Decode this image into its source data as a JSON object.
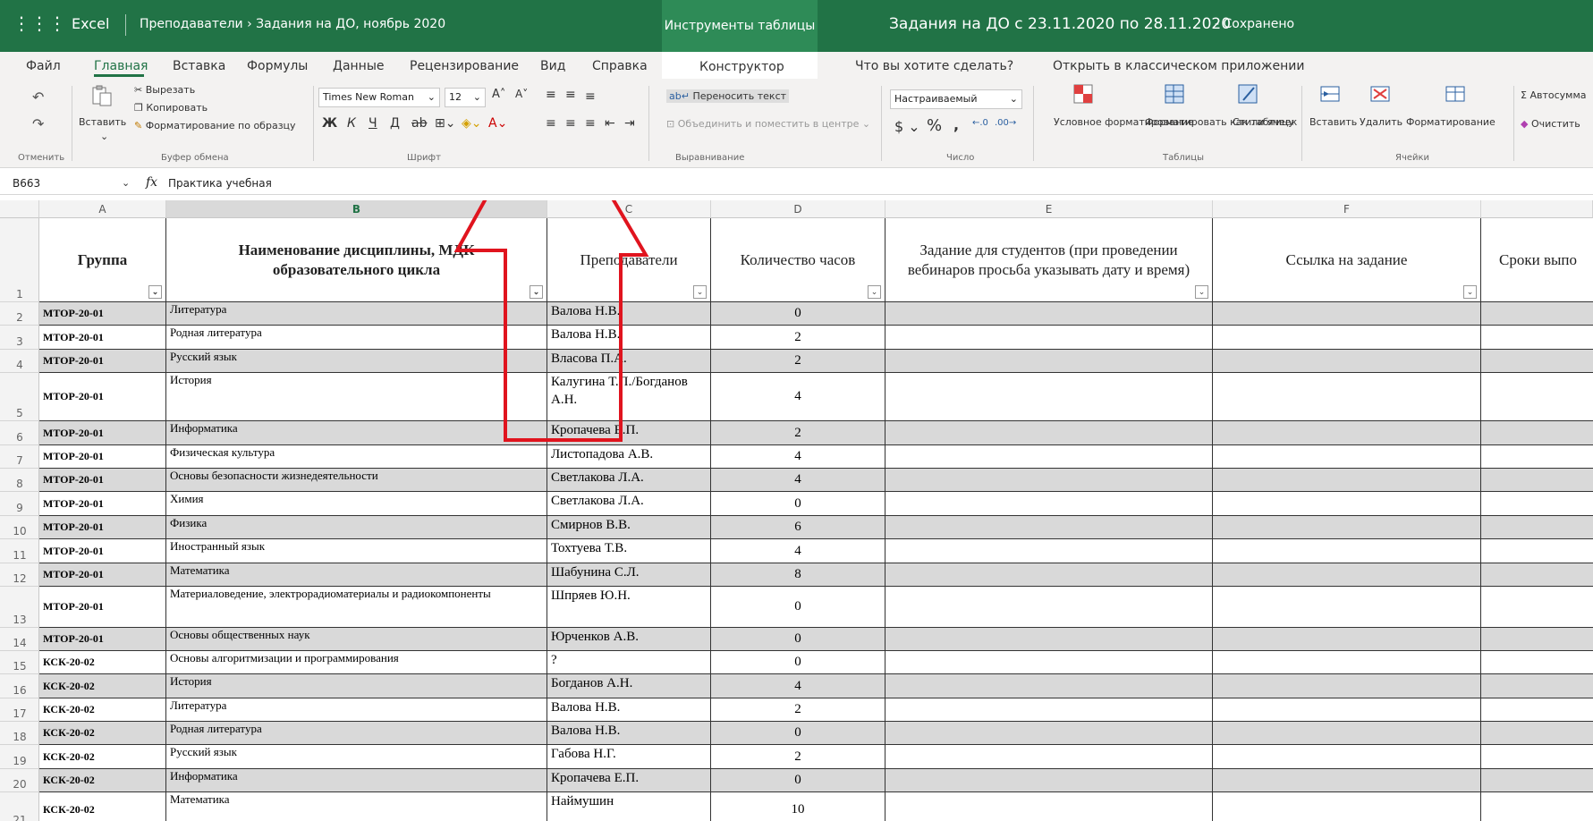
{
  "titlebar": {
    "app": "Excel",
    "breadcrumb": "Преподаватели › Задания на ДО, ноябрь 2020",
    "table_tools": "Инструменты таблицы",
    "file_title": "Задания на ДО с 23.11.2020 по 28.11.2020",
    "saved_status": "-  Сохранено"
  },
  "tabs": [
    "Файл",
    "Главная",
    "Вставка",
    "Формулы",
    "Данные",
    "Рецензирование",
    "Вид",
    "Справка",
    "Конструктор",
    "Что вы хотите сделать?",
    "Открыть в классическом приложении"
  ],
  "ribbon": {
    "undo_group": "Отменить",
    "paste": "Вставить",
    "cut": "Вырезать",
    "copy": "Копировать",
    "format_painter": "Форматирование по образцу",
    "clipboard_group": "Буфер обмена",
    "font_name": "Times New Roman",
    "font_size": "12",
    "font_group": "Шрифт",
    "wrap_text": "Переносить текст",
    "merge_center": "Объединить и поместить в центре",
    "alignment_group": "Выравнивание",
    "number_format": "Настраиваемый",
    "number_group": "Число",
    "cond_format": "Условное форматирование",
    "format_table": "Форматировать как таблицу",
    "cell_styles": "Стили ячеек",
    "tables_group": "Таблицы",
    "insert": "Вставить",
    "delete": "Удалить",
    "format": "Форматирование",
    "cells_group": "Ячейки",
    "autosum": "Автосумма",
    "clear": "Очистить"
  },
  "formula_bar": {
    "name_box": "B663",
    "fx": "fx",
    "formula": "Практика учебная"
  },
  "columns": [
    "A",
    "B",
    "C",
    "D",
    "E",
    "F"
  ],
  "header_row": {
    "row": "1",
    "group": "Группа",
    "discipline": "Наименование дисциплины, МДК образовательного цикла",
    "teacher": "Преподаватели",
    "hours": "Количество часов",
    "task": "Задание для студентов (при проведении вебинаров просьба указывать дату и время)",
    "link": "Ссылка на задание",
    "deadline": "Сроки выпо"
  },
  "rows": [
    {
      "n": "2",
      "group": "МТОР-20-01",
      "discipline": "Литература",
      "teacher": "Валова Н.В.",
      "hours": "0"
    },
    {
      "n": "3",
      "group": "МТОР-20-01",
      "discipline": "Родная литература",
      "teacher": "Валова Н.В.",
      "hours": "2"
    },
    {
      "n": "4",
      "group": "МТОР-20-01",
      "discipline": "Русский язык",
      "teacher": "Власова П.А.",
      "hours": "2"
    },
    {
      "n": "5",
      "group": "МТОР-20-01",
      "discipline": "История",
      "teacher": "Калугина Т.П./Богданов А.Н.",
      "hours": "4"
    },
    {
      "n": "6",
      "group": "МТОР-20-01",
      "discipline": "Информатика",
      "teacher": "Кропачева Е.П.",
      "hours": "2"
    },
    {
      "n": "7",
      "group": "МТОР-20-01",
      "discipline": "Физическая культура",
      "teacher": "Листопадова А.В.",
      "hours": "4"
    },
    {
      "n": "8",
      "group": "МТОР-20-01",
      "discipline": "Основы безопасности жизнедеятельности",
      "teacher": "Светлакова Л.А.",
      "hours": "4"
    },
    {
      "n": "9",
      "group": "МТОР-20-01",
      "discipline": "Химия",
      "teacher": "Светлакова Л.А.",
      "hours": "0"
    },
    {
      "n": "10",
      "group": "МТОР-20-01",
      "discipline": "Физика",
      "teacher": "Смирнов В.В.",
      "hours": "6"
    },
    {
      "n": "11",
      "group": "МТОР-20-01",
      "discipline": "Иностранный язык",
      "teacher": "Тохтуева Т.В.",
      "hours": "4"
    },
    {
      "n": "12",
      "group": "МТОР-20-01",
      "discipline": "Математика",
      "teacher": "Шабунина С.Л.",
      "hours": "8"
    },
    {
      "n": "13",
      "group": "МТОР-20-01",
      "discipline": "Материаловедение, электрорадиоматериалы и радиокомпоненты",
      "teacher": "Шпряев Ю.Н.",
      "hours": "0"
    },
    {
      "n": "14",
      "group": "МТОР-20-01",
      "discipline": "Основы общественных наук",
      "teacher": "Юрченков А.В.",
      "hours": "0"
    },
    {
      "n": "15",
      "group": "КСК-20-02",
      "discipline": "Основы алгоритмизации и программирования",
      "teacher": "?",
      "hours": "0"
    },
    {
      "n": "16",
      "group": "КСК-20-02",
      "discipline": "История",
      "teacher": "Богданов А.Н.",
      "hours": "4"
    },
    {
      "n": "17",
      "group": "КСК-20-02",
      "discipline": "Литература",
      "teacher": "Валова Н.В.",
      "hours": "2"
    },
    {
      "n": "18",
      "group": "КСК-20-02",
      "discipline": "Родная литература",
      "teacher": "Валова Н.В.",
      "hours": "0"
    },
    {
      "n": "19",
      "group": "КСК-20-02",
      "discipline": "Русский язык",
      "teacher": "Габова Н.Г.",
      "hours": "2"
    },
    {
      "n": "20",
      "group": "КСК-20-02",
      "discipline": "Информатика",
      "teacher": "Кропачева Е.П.",
      "hours": "0"
    },
    {
      "n": "21",
      "group": "КСК-20-02",
      "discipline": "Математика",
      "teacher": "Наймушин",
      "hours": "10"
    }
  ],
  "colors": {
    "excel_green": "#217346",
    "annotation_red": "#e0141e",
    "row_shade": "#d9d9d9"
  }
}
